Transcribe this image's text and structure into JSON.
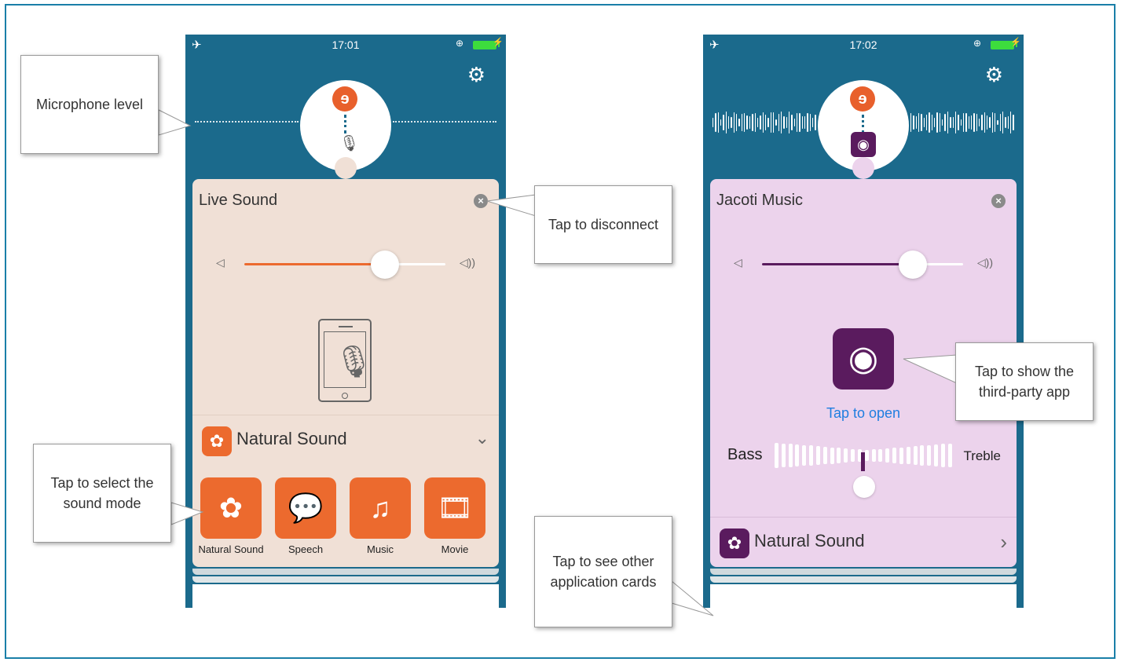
{
  "left_phone": {
    "status": {
      "time": "17:01"
    },
    "card": {
      "title": "Live Sound",
      "sound_mode": "Natural Sound",
      "modes": [
        {
          "label": "Natural Sound",
          "icon": "flower-icon"
        },
        {
          "label": "Speech",
          "icon": "speech-bubble-icon"
        },
        {
          "label": "Music",
          "icon": "music-note-icon"
        },
        {
          "label": "Movie",
          "icon": "film-icon"
        }
      ],
      "volume_fraction": 0.7
    },
    "accent": "#ec6a2e"
  },
  "right_phone": {
    "status": {
      "time": "17:02"
    },
    "card": {
      "title": "Jacoti Music",
      "tap_to_open": "Tap to open",
      "bass_label": "Bass",
      "treble_label": "Treble",
      "sound_mode": "Natural Sound",
      "volume_fraction": 0.75
    },
    "accent": "#5a1b5e"
  },
  "callouts": {
    "mic_level": "Microphone level",
    "disconnect": "Tap to disconnect",
    "select_mode": "Tap to select the sound mode",
    "third_party": "Tap to show the third-party app",
    "other_cards": "Tap to see other application cards"
  }
}
